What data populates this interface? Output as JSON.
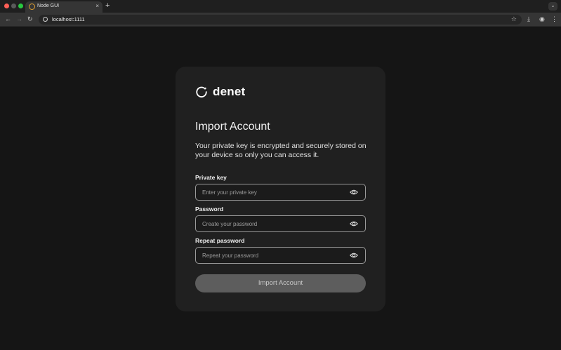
{
  "browser": {
    "tab_title": "Node GUI",
    "tab_close": "×",
    "new_tab": "+",
    "tab_search": "⌄",
    "url": "localhost:1111",
    "nav_back": "←",
    "nav_forward": "→",
    "nav_reload": "↻",
    "star": "☆",
    "download": "⤓",
    "profile": "◉",
    "menu": "⋮"
  },
  "brand": {
    "logo_text": "denet"
  },
  "form": {
    "title": "Import Account",
    "description": "Your private key is encrypted and securely stored on your device so only you can access it.",
    "fields": [
      {
        "label": "Private key",
        "placeholder": "Enter your private key",
        "value": ""
      },
      {
        "label": "Password",
        "placeholder": "Create your password",
        "value": ""
      },
      {
        "label": "Repeat password",
        "placeholder": "Repeat your password",
        "value": ""
      }
    ],
    "submit_label": "Import Account"
  },
  "icons": {
    "logo": "refresh-circle-icon",
    "field_toggle": "eye-icon"
  },
  "colors": {
    "page_bg": "#151515",
    "card_bg": "#202020",
    "button_bg": "#5d5d5d",
    "field_border": "#9a9a9a"
  }
}
